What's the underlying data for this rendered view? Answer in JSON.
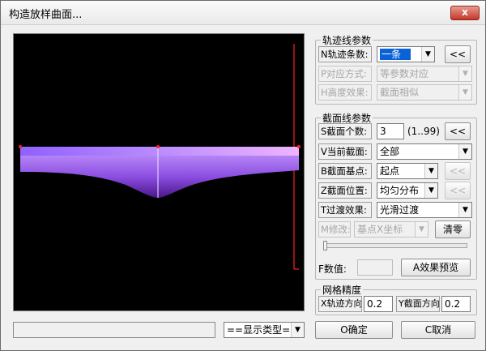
{
  "window": {
    "title": "构造放样曲面...",
    "close_label": "x"
  },
  "track_group": {
    "legend": "轨迹线参数",
    "count_label": "N轨迹条数:",
    "count_value": "一条",
    "count_more": "<<",
    "match_label": "P对应方式:",
    "match_value": "等参数对应",
    "height_label": "H高度效果:",
    "height_value": "截面相似"
  },
  "section_group": {
    "legend": "截面线参数",
    "count_label": "S截面个数:",
    "count_value": "3",
    "count_range": "(1..99)",
    "count_more": "<<",
    "current_label": "V当前截面:",
    "current_value": "全部",
    "base_label": "B截面基点:",
    "base_value": "起点",
    "base_more": "<<",
    "position_label": "Z截面位置:",
    "position_value": "均匀分布",
    "position_more": "<<",
    "transition_label": "T过渡效果:",
    "transition_value": "光滑过渡",
    "modify_label": "M修改:",
    "modify_value": "基点X坐标",
    "reset_label": "清零",
    "slider_value": 0,
    "f_label": "F数值:",
    "f_value": "",
    "preview_label": "A效果预览"
  },
  "mesh_group": {
    "legend": "网格精度",
    "x_label": "X轨迹方向",
    "x_value": "0.2",
    "y_label": "Y截面方向",
    "y_value": "0.2"
  },
  "bottom": {
    "status_text": "",
    "display_type": "==显示类型==",
    "ok_label": "O确定",
    "cancel_label": "C取消"
  },
  "colors": {
    "surface_top": "#f6c8ff",
    "surface_mid": "#b57cff",
    "surface_dark": "#5a1ea0",
    "viewport_bg": "#000000",
    "edge_red": "#ff2020"
  }
}
